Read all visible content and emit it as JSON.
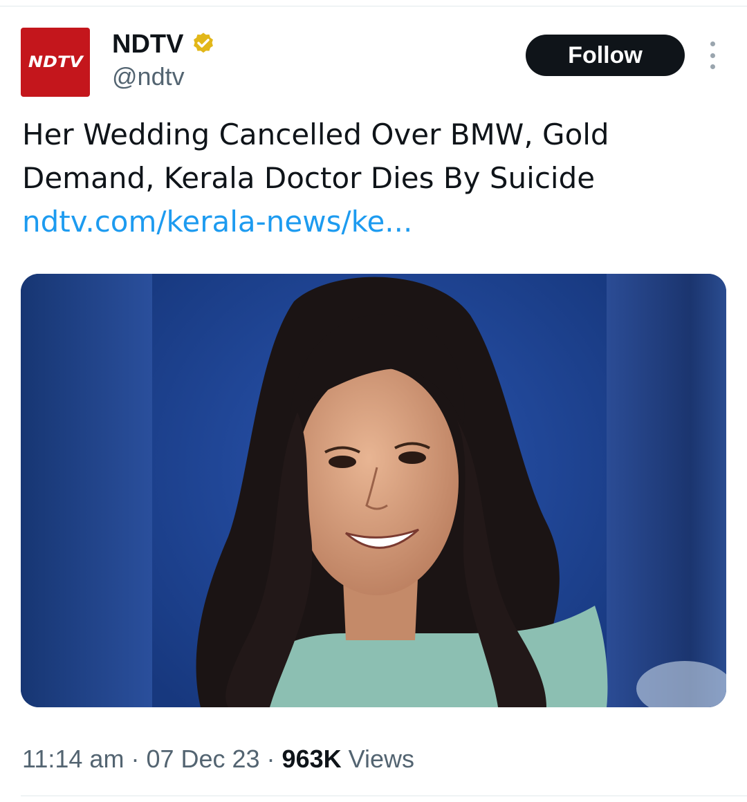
{
  "author": {
    "avatar_text": "NDTV",
    "display_name": "NDTV",
    "handle": "@ndtv",
    "verified_icon": "verified-badge-gold"
  },
  "actions": {
    "follow_label": "Follow",
    "more_icon": "more-vertical-icon"
  },
  "tweet": {
    "text": "Her Wedding Cancelled Over BMW, Gold Demand, Kerala Doctor Dies By Suicide",
    "link": "ndtv.com/kerala-news/ke..."
  },
  "meta": {
    "time": "11:14 am",
    "sep1": " · ",
    "date": "07 Dec 23",
    "sep2": " · ",
    "views_count": "963K",
    "views_label": " Views"
  },
  "colors": {
    "brand_red": "#c4161c",
    "link_blue": "#1d9bf0",
    "badge_gold": "#e2b719",
    "muted": "#536471"
  }
}
